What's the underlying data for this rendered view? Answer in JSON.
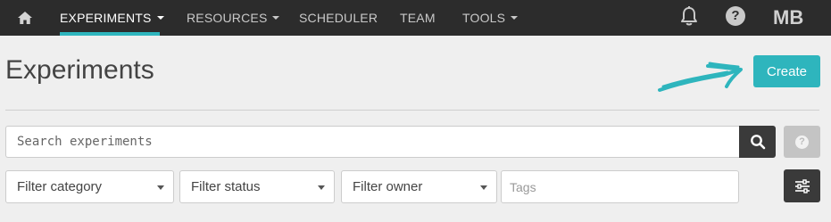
{
  "nav": {
    "home_icon": "home-icon",
    "items": [
      {
        "label": "EXPERIMENTS",
        "dropdown": true,
        "active": true
      },
      {
        "label": "RESOURCES",
        "dropdown": true,
        "active": false
      },
      {
        "label": "SCHEDULER",
        "dropdown": false,
        "active": false
      },
      {
        "label": "TEAM",
        "dropdown": false,
        "active": false
      },
      {
        "label": "TOOLS",
        "dropdown": true,
        "active": false
      }
    ],
    "bell_icon": "bell-icon",
    "help_icon": "help-icon",
    "help_glyph": "?",
    "user_initials": "MB"
  },
  "header": {
    "title": "Experiments",
    "create_label": "Create"
  },
  "search": {
    "placeholder": "Search experiments",
    "value": "",
    "search_icon": "search-icon",
    "help_glyph": "?"
  },
  "filters": {
    "category": "Filter category",
    "status": "Filter status",
    "owner": "Filter owner",
    "tags_placeholder": "Tags",
    "settings_icon": "sliders-icon"
  },
  "colors": {
    "accent": "#2eb5bd",
    "navbar": "#2c2c2c",
    "background": "#efefef",
    "dark_button": "#3a3a3a"
  }
}
